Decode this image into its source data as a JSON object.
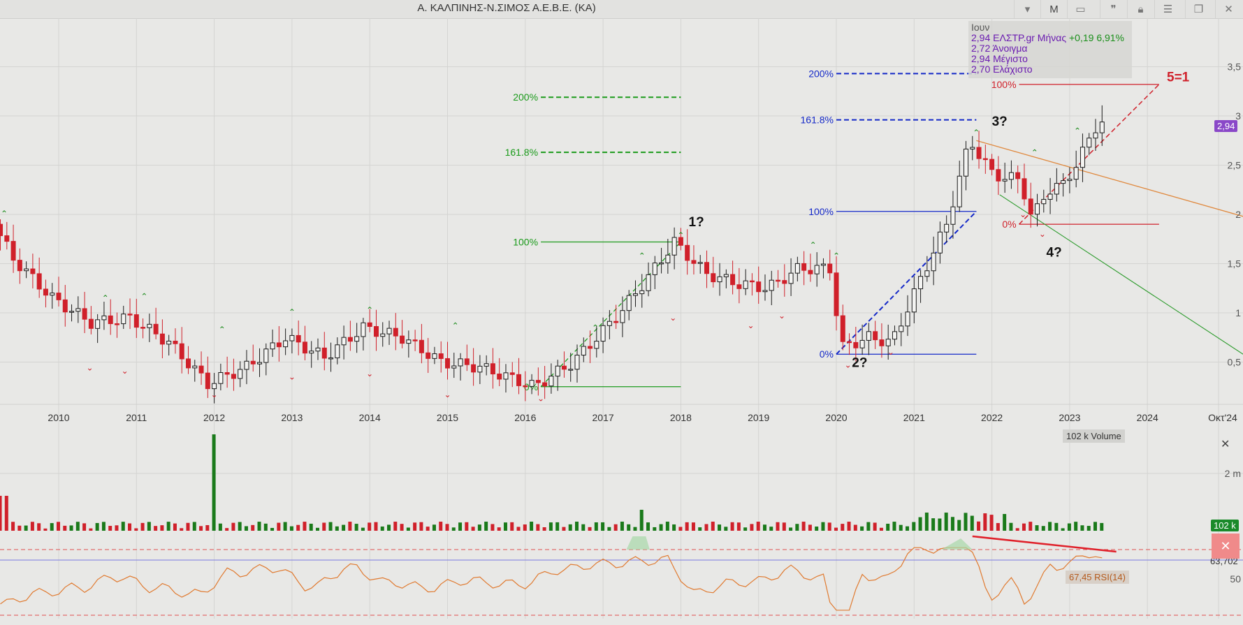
{
  "window": {
    "title": "Α. ΚΑΛΠΙΝΗΣ-Ν.ΣΙΜΟΣ Α.Ε.Β.Ε. (ΚΑ)",
    "period_button": "M"
  },
  "ohlc": {
    "month": "Ιουν",
    "close_line": "2,94 ΕΛΣΤΡ.gr Μήνας",
    "change": "+0,19 6,91%",
    "open": "2,72 Άνοιγμα",
    "high": "2,94 Μέγιστο",
    "low": "2,70 Ελάχιστο"
  },
  "badges": {
    "last_price": "2,94",
    "last_volume": "102 k",
    "rsi_value": "63,702"
  },
  "volume_legend": "102 k Volume",
  "rsi_legend": "67,45 RSI(14)",
  "colors": {
    "up": "#1a1a1a",
    "down": "#d0202a",
    "fib_green": "#1a9a1a",
    "fib_blue": "#1428c8",
    "fib_red": "#d0202a",
    "rsi": "#e07a30",
    "vol_up": "#1a7a1a",
    "vol_down": "#d0202a",
    "badge_price": "#8a48c8",
    "badge_vol": "#1a8a2a"
  },
  "chart_data": {
    "type": "candlestick",
    "x_tick_labels": [
      "2010",
      "2011",
      "2012",
      "2013",
      "2014",
      "2015",
      "2016",
      "2017",
      "2018",
      "2019",
      "2020",
      "2021",
      "2022",
      "2023",
      "2024",
      "Οκτ'24"
    ],
    "y_tick_labels": [
      "0,5",
      "1",
      "1,5",
      "2",
      "2,5",
      "3",
      "3,5"
    ],
    "ylim": [
      0.0,
      3.8
    ],
    "x_start": 2009.25,
    "key_prices": {
      "start": 1.9,
      "low_2012": 0.25,
      "low_2016": 0.25,
      "peak_2018": 1.72,
      "low_2020": 0.58,
      "peak_2021": 2.75,
      "low_2022": 1.9,
      "last": 2.94
    },
    "wave_labels": [
      {
        "text": "1?",
        "x": 2018.1,
        "y": 1.88
      },
      {
        "text": "2?",
        "x": 2020.2,
        "y": 0.45
      },
      {
        "text": "3?",
        "x": 2022.0,
        "y": 2.9
      },
      {
        "text": "4?",
        "x": 2022.7,
        "y": 1.57
      },
      {
        "text": "5=1",
        "x": 2024.25,
        "y": 3.35
      }
    ],
    "fib_green": {
      "levels": [
        "0%",
        "100%",
        "161.8%",
        "200%"
      ],
      "values": [
        0.25,
        1.72,
        2.63,
        3.19
      ],
      "x_start": 2016.2,
      "x_end": 2018.0
    },
    "fib_blue": {
      "levels": [
        "0%",
        "100%",
        "161.8%",
        "200%"
      ],
      "values": [
        0.58,
        2.03,
        2.96,
        3.43
      ],
      "x_start": 2020.0,
      "x_end": 2021.8
    },
    "fib_red": {
      "levels": [
        "0%",
        "100%"
      ],
      "values": [
        1.9,
        3.32
      ],
      "x_start": 2022.35,
      "x_end": 2024.15
    },
    "volume": {
      "ytick": "2 m"
    },
    "rsi": {
      "yticks": [
        "50"
      ],
      "period": 14
    }
  }
}
